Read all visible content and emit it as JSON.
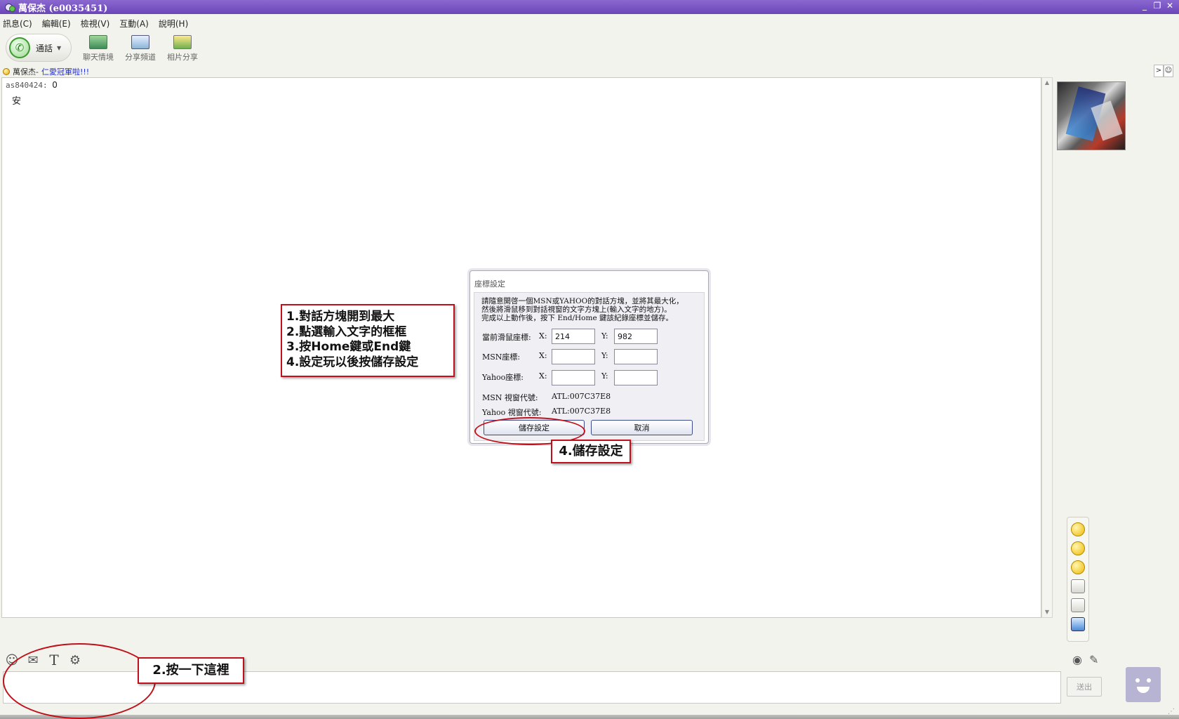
{
  "window": {
    "title": "萬保杰 (e0035451)",
    "buttons": [
      "_",
      "❐",
      "✕"
    ]
  },
  "menu": [
    "訊息(C)",
    "編輯(E)",
    "檢視(V)",
    "互動(A)",
    "說明(H)"
  ],
  "toolbar": {
    "call_label": "通話",
    "chat_mood": "聊天情境",
    "share_channel": "分享頻道",
    "photo_share": "相片分享"
  },
  "status": {
    "name": "萬保杰",
    "separator": " - ",
    "message": "仁愛冠軍啦!!!"
  },
  "chat": {
    "sender": "as840424:",
    "sender_value": "0",
    "message": "安"
  },
  "dialog": {
    "title": "座標設定",
    "desc1": "請隨意開啓一個MSN或YAHOO的對話方塊，並將其最大化，",
    "desc2": "然後將滑鼠移到對話視窗的文字方塊上(輸入文字的地方)。",
    "desc3": "完成以上動作後，按下 End/Home 鍵該紀錄座標並儲存。",
    "current_label": "當前滑鼠座標:",
    "msn_label": "MSN座標:",
    "yahoo_label": "Yahoo座標:",
    "x_label": "X:",
    "y_label": "Y:",
    "current_x": "214",
    "current_y": "982",
    "msn_x": "",
    "msn_y": "",
    "yahoo_x": "",
    "yahoo_y": "",
    "msn_handle_label": "MSN 視窗代號:",
    "msn_handle": "ATL:007C37E8",
    "yahoo_handle_label": "Yahoo 視窗代號:",
    "yahoo_handle": "ATL:007C37E8",
    "save_button": "儲存設定",
    "cancel_button": "取消"
  },
  "annotations": {
    "step1": "1.對話方塊開到最大",
    "step2": "2.點選輸入文字的框框",
    "step3": "3.按Home鍵或End鍵",
    "step4": "4.設定玩以後按儲存設定",
    "save_note": "4.儲存設定",
    "click_note": "2.按一下這裡"
  },
  "input": {
    "send_label": "送出"
  },
  "colors": {
    "titlebar": "#6a45b8",
    "annotation_red": "#c0101a",
    "status_link": "#1c2ad8"
  }
}
